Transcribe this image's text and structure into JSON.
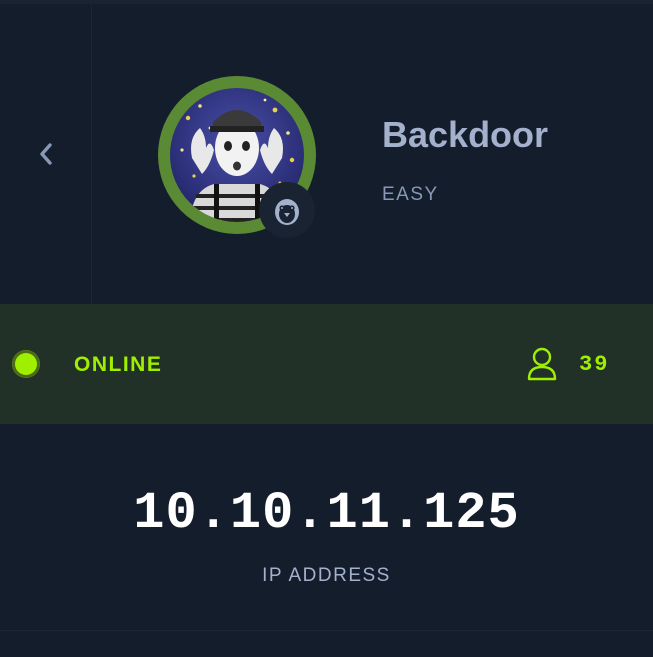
{
  "header": {
    "back_icon": "chevron-left-icon",
    "machine_name": "Backdoor",
    "difficulty": "EASY",
    "os_icon": "linux-penguin-icon"
  },
  "status": {
    "label": "ONLINE",
    "users_icon": "user-icon",
    "users_count": "39"
  },
  "ip": {
    "value": "10.10.11.125",
    "label": "IP ADDRESS"
  },
  "colors": {
    "background": "#141d2b",
    "status_background": "#223127",
    "accent_green": "#9fef00",
    "avatar_ring": "#5b8a34",
    "title_text": "#a4b1cd",
    "difficulty_text": "#8799b5",
    "ip_text": "#ffffff"
  }
}
